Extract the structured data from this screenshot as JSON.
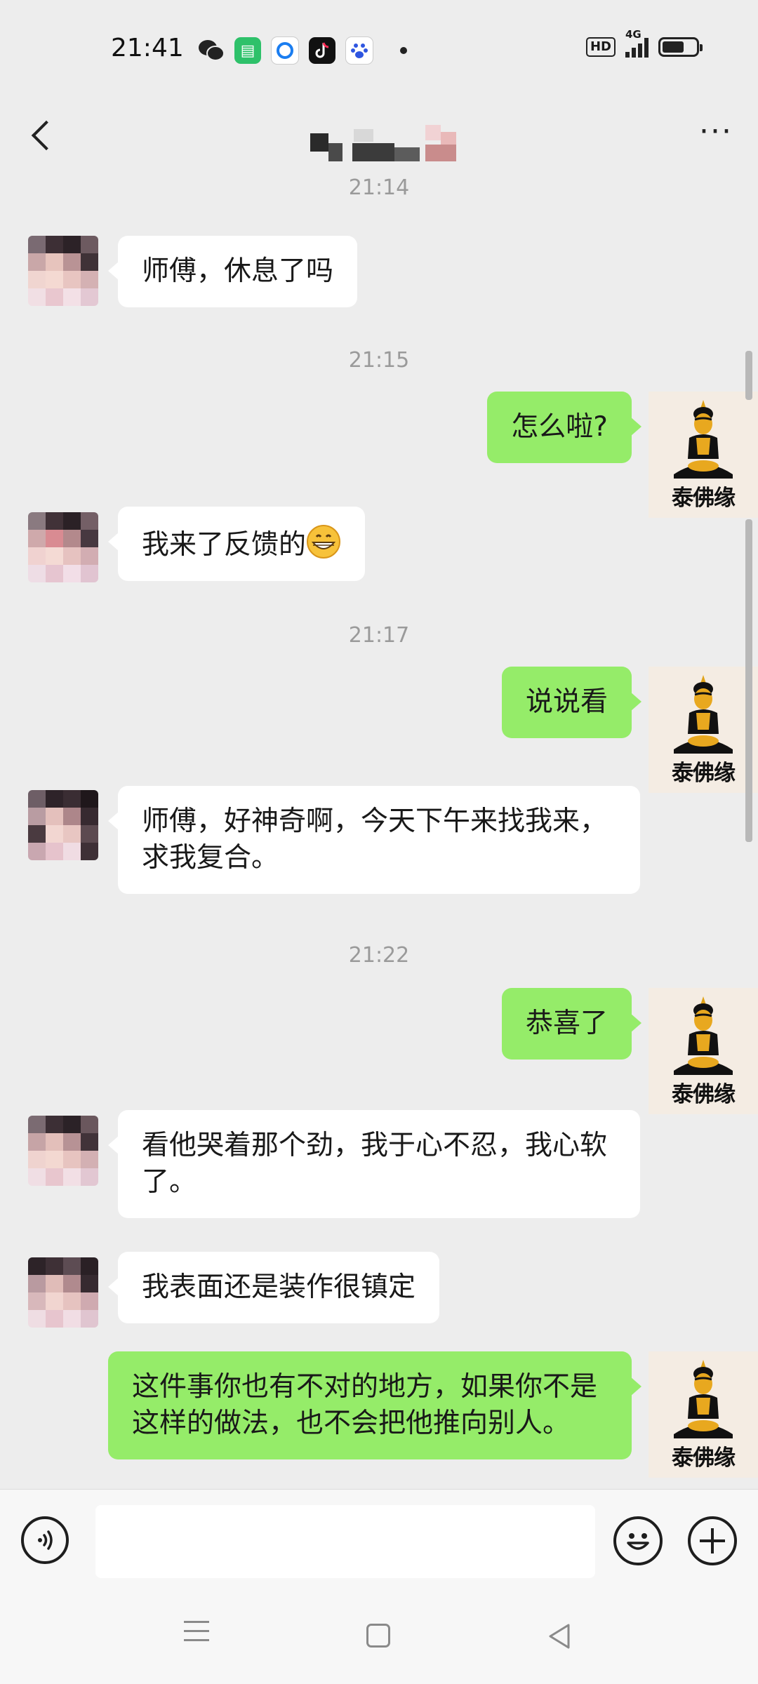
{
  "status_bar": {
    "time": "21:41",
    "hd": "HD",
    "network": "4G",
    "icons": [
      "wechat-icon",
      "app-store-icon",
      "browser-icon",
      "tiktok-icon",
      "baidu-icon"
    ]
  },
  "header": {
    "back_icon": "chevron-left-icon",
    "more_icon": "more-dots-icon",
    "more_label": "···"
  },
  "avatar_right": {
    "brand": "泰佛缘"
  },
  "messages": [
    {
      "type": "time",
      "text": "21:14"
    },
    {
      "type": "in",
      "text": "师傅，休息了吗"
    },
    {
      "type": "time",
      "text": "21:15"
    },
    {
      "type": "out",
      "text": "怎么啦?"
    },
    {
      "type": "in",
      "text": "我来了反馈的",
      "emoji": "grinning-face-icon"
    },
    {
      "type": "time",
      "text": "21:17"
    },
    {
      "type": "out",
      "text": "说说看"
    },
    {
      "type": "in",
      "text": "师傅，好神奇啊，今天下午来找我来，求我复合。"
    },
    {
      "type": "time",
      "text": "21:22"
    },
    {
      "type": "out",
      "text": "恭喜了"
    },
    {
      "type": "in",
      "text": "看他哭着那个劲，我于心不忍，我心软了。"
    },
    {
      "type": "in",
      "text": "我表面还是装作很镇定"
    },
    {
      "type": "out",
      "text": "这件事你也有不对的地方，如果你不是这样的做法，也不会把他推向别人。"
    }
  ],
  "input_bar": {
    "voice_icon": "voice-icon",
    "emoji_icon": "emoji-icon",
    "plus_icon": "plus-icon",
    "text_value": ""
  },
  "colors": {
    "background": "#ededed",
    "bubble_out": "#95ec69",
    "bubble_in": "#ffffff",
    "timestamp": "#9a9a9a"
  }
}
